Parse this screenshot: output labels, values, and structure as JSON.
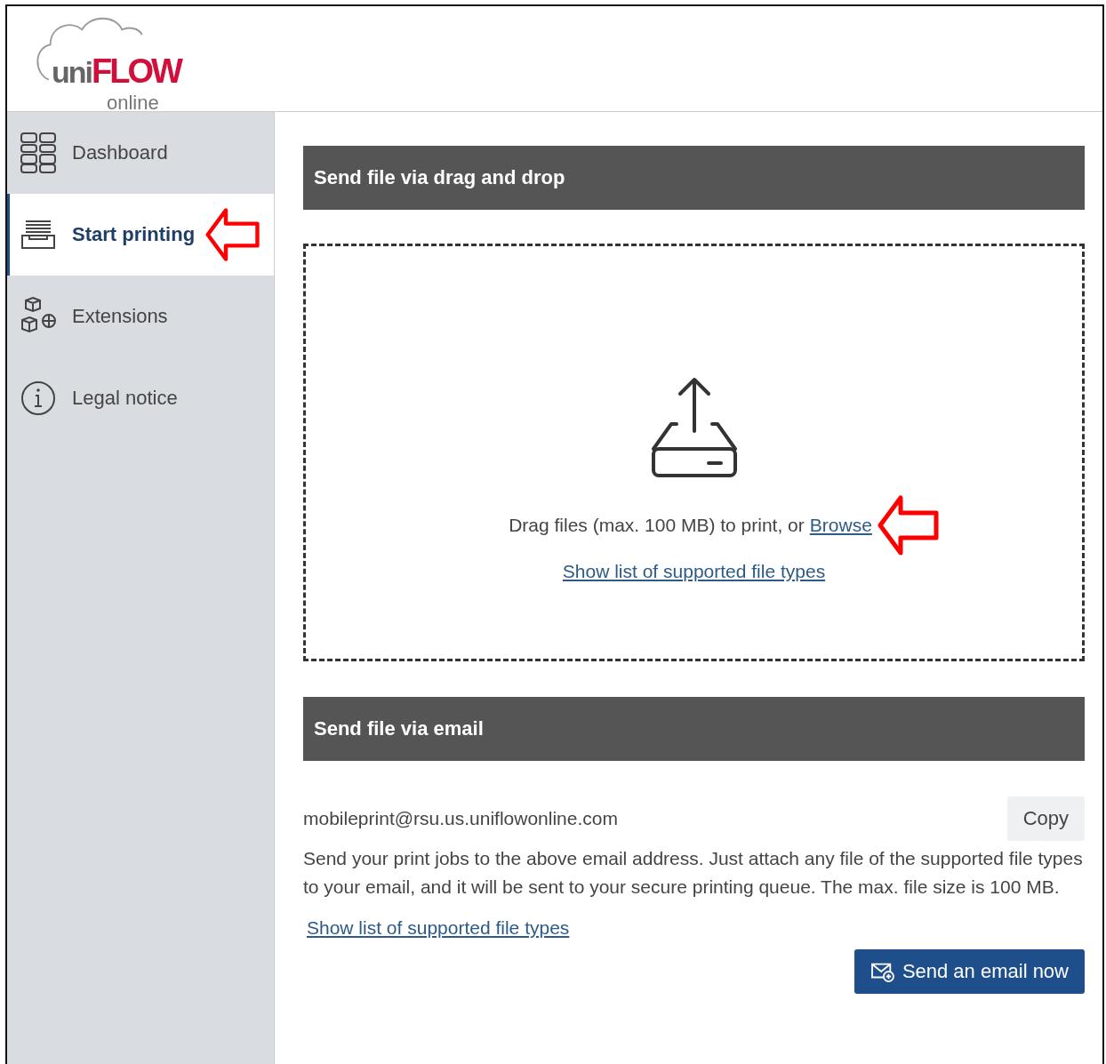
{
  "logo": {
    "prefix": "uni",
    "brand": "FLOW",
    "tagline": "online"
  },
  "sidebar": {
    "items": [
      {
        "label": "Dashboard",
        "selected": false
      },
      {
        "label": "Start printing",
        "selected": true,
        "annotated": true
      },
      {
        "label": "Extensions",
        "selected": false
      },
      {
        "label": "Legal notice",
        "selected": false
      }
    ]
  },
  "drag_drop": {
    "title": "Send file via drag and drop",
    "prompt": "Drag files (max. 100 MB) to print, or",
    "browse_link": "Browse",
    "browse_annotated": true,
    "types_link": "Show list of supported file types"
  },
  "email": {
    "title": "Send file via email",
    "address": "mobileprint@rsu.us.uniflowonline.com",
    "copy_button": "Copy",
    "description": "Send your print jobs to the above email address. Just attach any file of the supported file types to your email, and it will be sent to your secure printing queue. The max. file size is 100 MB.",
    "types_link": "Show list of supported file types",
    "send_button": "Send an email now"
  }
}
